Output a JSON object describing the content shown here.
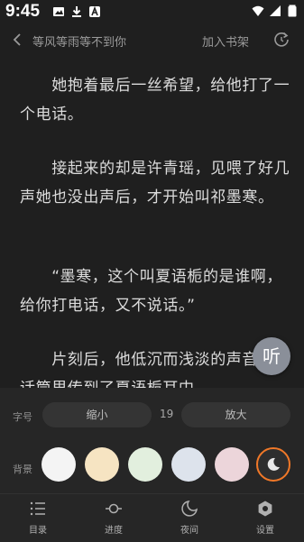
{
  "status_bar": {
    "time": "9:45",
    "left_icons": [
      "image-icon",
      "download-icon",
      "app-a-icon"
    ],
    "right_icons": [
      "wifi-icon",
      "signal-icon",
      "battery-icon"
    ]
  },
  "top_nav": {
    "book_title": "等风等雨等不到你",
    "add_to_shelf": "加入书架"
  },
  "reader": {
    "paragraphs": [
      "　　她抱着最后一丝希望，给他打了一个电话。",
      "　　接起来的却是许青瑶，见喂了好几声她也没出声后，才开始叫祁墨寒。",
      "　　“墨寒，这个叫夏语栀的是谁啊，给你打电话，又不说话。”",
      "　　片刻后，他低沉而浅淡的声音透过话筒里传到了夏语栀耳中。"
    ],
    "listen_label": "听"
  },
  "settings": {
    "font_label": "字号",
    "smaller_label": "缩小",
    "font_size": "19",
    "larger_label": "放大",
    "background_label": "背景",
    "swatches": [
      "#f4f4f4",
      "#f6e4c2",
      "#e2efde",
      "#dde3ec",
      "#ecd5da",
      "#2e2e2e"
    ],
    "selected_swatch_border": "#f07828"
  },
  "bottom_tabs": [
    {
      "label": "目录",
      "icon": "list-icon"
    },
    {
      "label": "进度",
      "icon": "progress-icon"
    },
    {
      "label": "夜间",
      "icon": "night-icon"
    },
    {
      "label": "设置",
      "icon": "settings-icon"
    }
  ]
}
